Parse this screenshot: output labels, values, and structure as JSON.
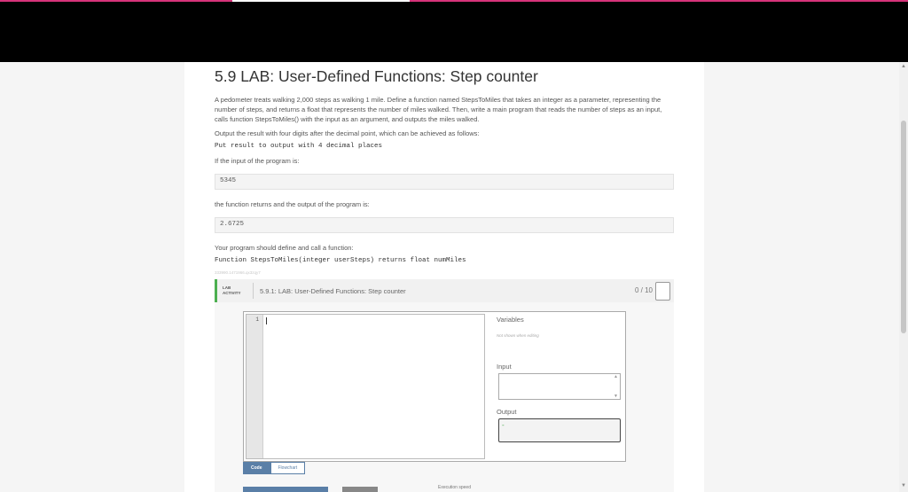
{
  "page": {
    "title": "5.9 LAB: User-Defined Functions: Step counter",
    "para1": "A pedometer treats walking 2,000 steps as walking 1 mile. Define a function named StepsToMiles that takes an integer as a parameter, representing the number of steps, and returns a float that represents the number of miles walked. Then, write a main program that reads the number of steps as an input, calls function StepsToMiles() with the input as an argument, and outputs the miles walked.",
    "para2": "Output the result with four digits after the decimal point, which can be achieved as follows:",
    "code1": "Put result to output with 4 decimal places",
    "para3": "If the input of the program is:",
    "input_example": "5345",
    "para4": "the function returns and the output of the program is:",
    "output_example": "2.6725",
    "para5": "Your program should define and call a function:",
    "code2": "Function StepsToMiles(integer userSteps) returns float numMiles",
    "meta": "333990.1471966.qx3zqy7"
  },
  "lab": {
    "tag_line1": "LAB",
    "tag_line2": "ACTIVITY",
    "title": "5.9.1: LAB: User-Defined Functions: Step counter",
    "score": "0 / 10",
    "line_number": "1",
    "variables_label": "Variables",
    "variables_note": "Not shown when editing",
    "input_label": "Input",
    "output_label": "Output",
    "output_value": "-",
    "tab_code": "Code",
    "tab_flowchart": "Flowchart",
    "execution_speed": "Execution speed"
  },
  "colors": {
    "accent_green": "#4caf50",
    "tab_blue": "#5a7fa7",
    "topbar_pink": "#d6337a"
  }
}
